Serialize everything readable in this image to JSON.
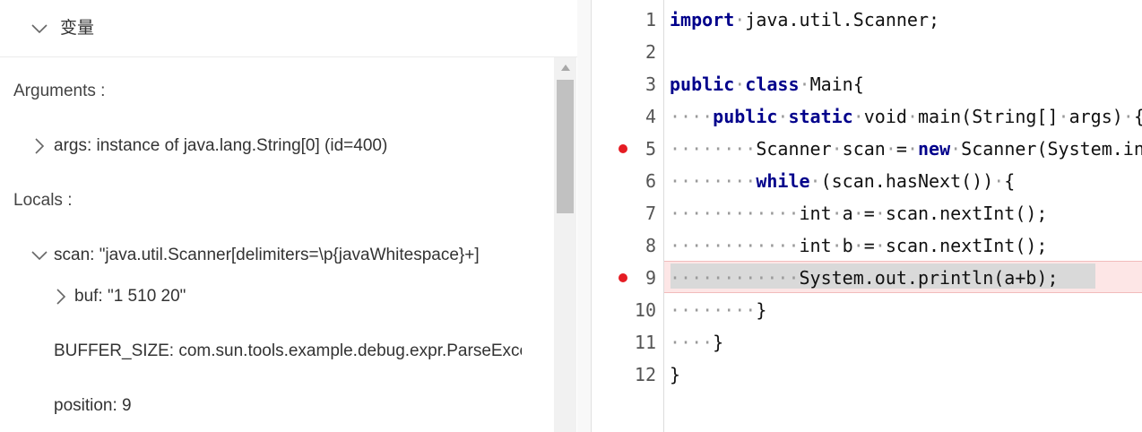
{
  "variables_panel": {
    "title": "变量",
    "arguments_label": "Arguments :",
    "args_value": "args: instance of java.lang.String[0] (id=400)",
    "locals_label": "Locals :",
    "scan_value": "scan: \"java.util.Scanner[delimiters=\\p{javaWhitespace}+]",
    "buf_value": "buf: \"1 510 20\"",
    "buffer_size_value": "BUFFER_SIZE: com.sun.tools.example.debug.expr.ParseException",
    "position_value": "position: 9"
  },
  "editor": {
    "breakpoint_color": "#e51c23",
    "lines": [
      {
        "n": "1"
      },
      {
        "n": "2"
      },
      {
        "n": "3"
      },
      {
        "n": "4"
      },
      {
        "n": "5"
      },
      {
        "n": "6"
      },
      {
        "n": "7"
      },
      {
        "n": "8"
      },
      {
        "n": "9"
      },
      {
        "n": "10"
      },
      {
        "n": "11"
      },
      {
        "n": "12"
      }
    ],
    "code": {
      "l1_kw": "import",
      "l1_rest": "java.util.Scanner;",
      "l3_kw1": "public",
      "l3_kw2": "class",
      "l3_rest": "Main{",
      "l4_kw1": "public",
      "l4_kw2": "static",
      "l4_rest": "void·main(String[]·args)·{",
      "l5_a": "Scanner·scan·=·",
      "l5_kw": "new",
      "l5_b": "·Scanner(System.in);",
      "l6_kw": "while",
      "l6_rest": "·(scan.hasNext())·{",
      "l7": "int·a·=·scan.nextInt();",
      "l8": "int·b·=·scan.nextInt();",
      "l9": "System.out.println(a+b);",
      "l10": "}",
      "l11": "}",
      "l12": "}"
    }
  }
}
